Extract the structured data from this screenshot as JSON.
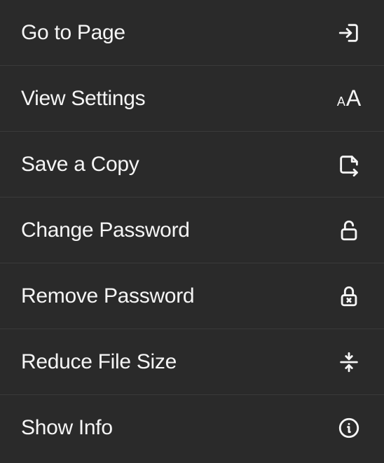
{
  "menu": {
    "items": [
      {
        "label": "Go to Page",
        "icon": "page-arrow-icon"
      },
      {
        "label": "View Settings",
        "icon": "text-size-icon"
      },
      {
        "label": "Save a Copy",
        "icon": "save-export-icon"
      },
      {
        "label": "Change Password",
        "icon": "unlock-icon"
      },
      {
        "label": "Remove Password",
        "icon": "lock-x-icon"
      },
      {
        "label": "Reduce File Size",
        "icon": "compress-icon"
      },
      {
        "label": "Show Info",
        "icon": "info-icon"
      }
    ]
  }
}
